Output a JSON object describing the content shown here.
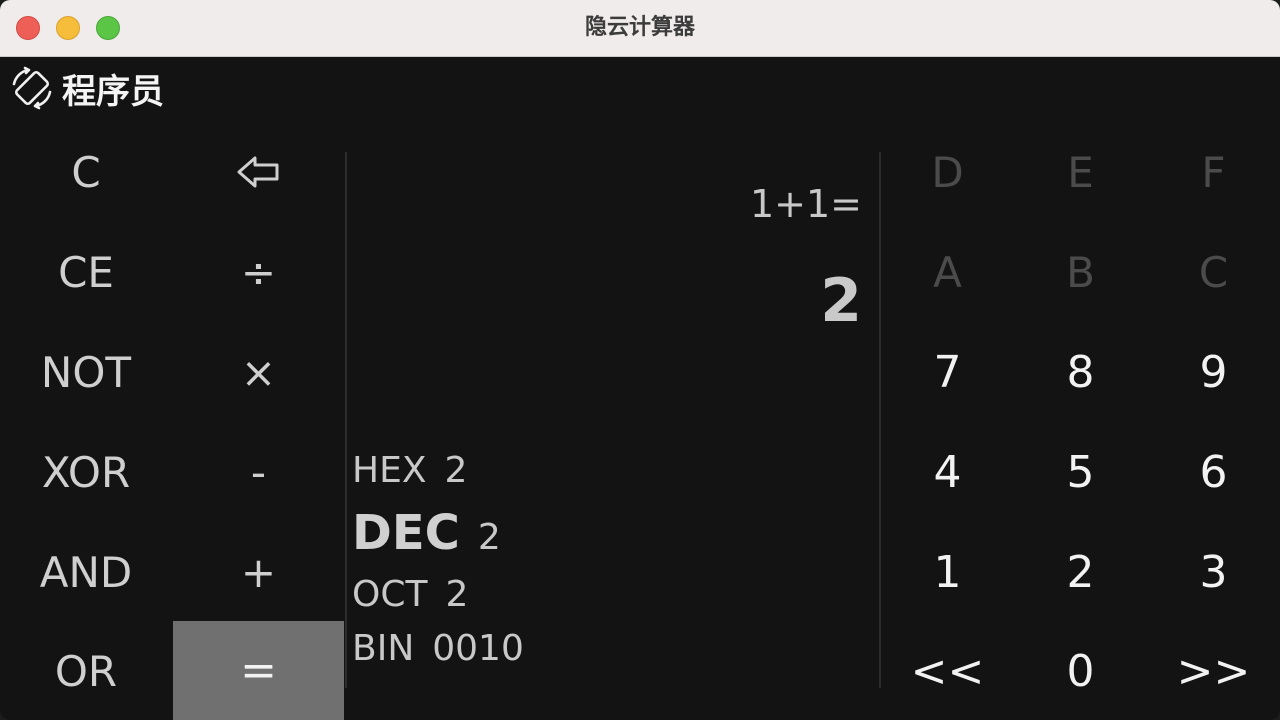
{
  "window": {
    "title": "隐云计算器"
  },
  "mode": {
    "label": "程序员",
    "icon": "rotate-device-icon"
  },
  "display": {
    "expression": "1+1=",
    "result": "2",
    "bases": [
      {
        "name": "HEX",
        "value": "2"
      },
      {
        "name": "DEC",
        "value": "2"
      },
      {
        "name": "OCT",
        "value": "2"
      },
      {
        "name": "BIN",
        "value": "0010"
      }
    ]
  },
  "keys": {
    "left": [
      {
        "label": "C",
        "name": "clear-button"
      },
      {
        "label": "CE",
        "name": "clear-entry-button"
      },
      {
        "label": "NOT",
        "name": "not-button"
      },
      {
        "label": "XOR",
        "name": "xor-button"
      },
      {
        "label": "AND",
        "name": "and-button"
      },
      {
        "label": "OR",
        "name": "or-button"
      }
    ],
    "ops": [
      {
        "label": "⇦",
        "name": "backspace-button"
      },
      {
        "label": "÷",
        "name": "divide-button"
      },
      {
        "label": "×",
        "name": "multiply-button"
      },
      {
        "label": "-",
        "name": "subtract-button"
      },
      {
        "label": "+",
        "name": "add-button"
      },
      {
        "label": "=",
        "name": "equals-button"
      }
    ],
    "pad": [
      [
        "D",
        "E",
        "F"
      ],
      [
        "A",
        "B",
        "C"
      ],
      [
        "7",
        "8",
        "9"
      ],
      [
        "4",
        "5",
        "6"
      ],
      [
        "1",
        "2",
        "3"
      ],
      [
        "<<",
        "0",
        ">>"
      ]
    ]
  }
}
